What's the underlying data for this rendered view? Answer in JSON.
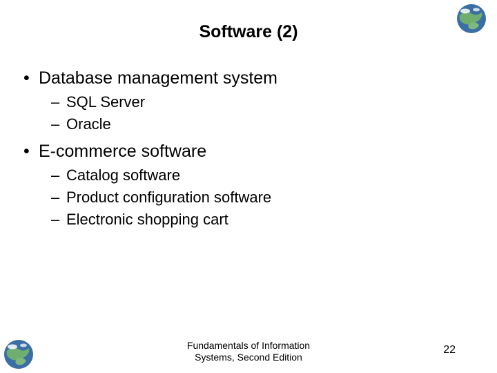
{
  "title": "Software (2)",
  "bullets": {
    "item0": {
      "label": "Database management system",
      "sub0": "SQL Server",
      "sub1": "Oracle"
    },
    "item1": {
      "label": "E-commerce software",
      "sub0": "Catalog software",
      "sub1": "Product configuration software",
      "sub2": "Electronic shopping cart"
    }
  },
  "footer": {
    "line1": "Fundamentals of Information",
    "line2": "Systems, Second Edition"
  },
  "page_number": "22"
}
